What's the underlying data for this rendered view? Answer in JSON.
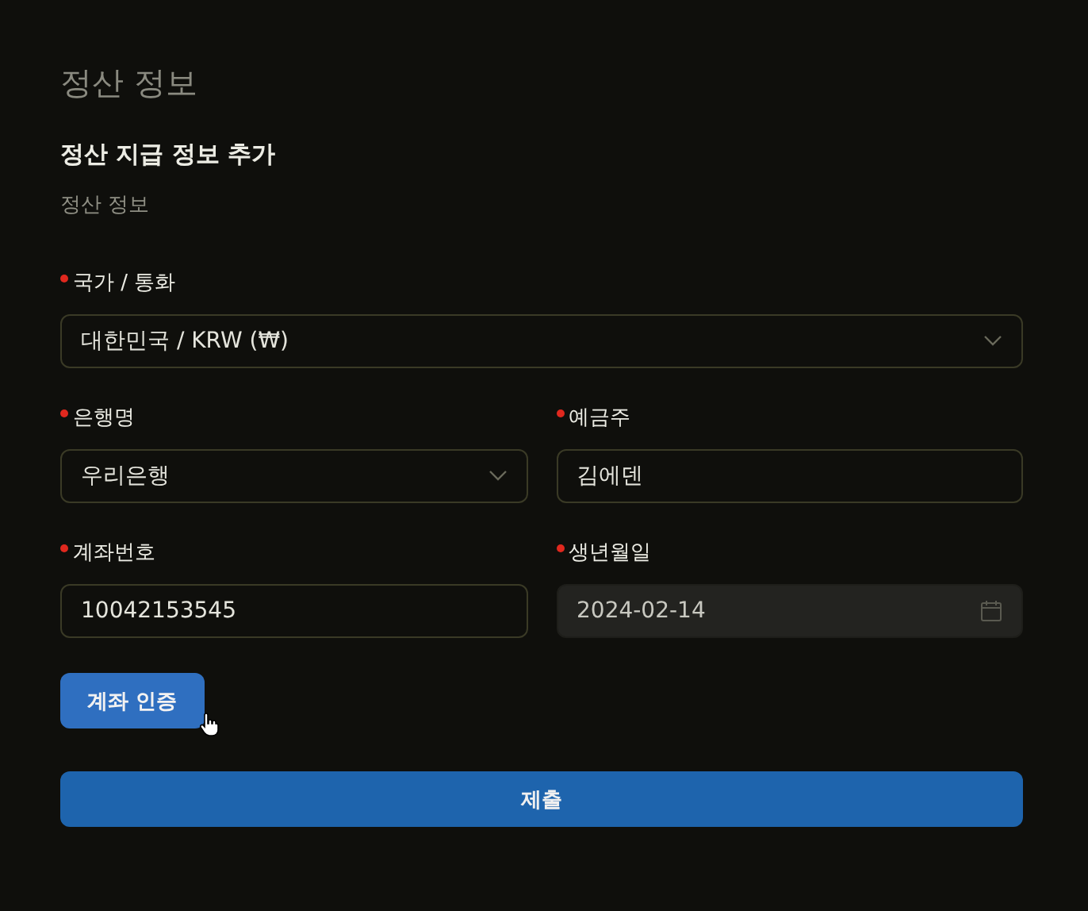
{
  "page_title": "정산 정보",
  "form": {
    "title": "정산 지급 정보 추가",
    "section": "정산 정보",
    "rows": [
      [
        {
          "label": "국가 / 통화",
          "required": true,
          "kind": "select",
          "value": "대한민국 / KRW (₩)",
          "disabled": false
        }
      ],
      [
        {
          "label": "은행명",
          "required": true,
          "kind": "select",
          "value": "우리은행",
          "disabled": false
        },
        {
          "label": "예금주",
          "required": true,
          "kind": "input",
          "value": "김에덴",
          "disabled": false
        }
      ],
      [
        {
          "label": "계좌번호",
          "required": true,
          "kind": "input",
          "value": "10042153545",
          "disabled": false
        },
        {
          "label": "생년월일",
          "required": true,
          "kind": "date",
          "value": "2024-02-14",
          "disabled": true
        }
      ]
    ],
    "verify_button": "계좌 인증",
    "submit_button": "제출"
  }
}
